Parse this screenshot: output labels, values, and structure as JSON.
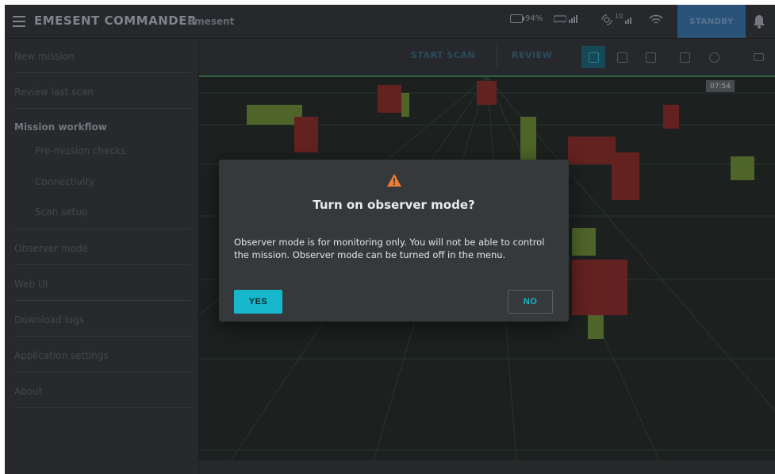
{
  "header": {
    "app_title": "EMESENT COMMANDER",
    "org": "Emesent",
    "battery": "94%",
    "satellites": "10",
    "standby_label": "STANDBY"
  },
  "sidebar": {
    "items": [
      {
        "label": "New mission"
      },
      {
        "label": "Review last scan"
      },
      {
        "label": "Mission workflow"
      },
      {
        "label": "Pre-mission checks"
      },
      {
        "label": "Connectivity"
      },
      {
        "label": "Scan setup"
      },
      {
        "label": "Observer mode"
      },
      {
        "label": "Web UI"
      },
      {
        "label": "Download logs"
      },
      {
        "label": "Application settings"
      },
      {
        "label": "About"
      }
    ]
  },
  "toolbar": {
    "start_scan": "START SCAN",
    "review": "REVIEW",
    "views": [
      "cube-view-icon",
      "front-view-icon",
      "side-view-icon",
      "top-view-icon",
      "fit-view-icon",
      "camera-icon"
    ]
  },
  "viewport": {
    "elapsed_time": "07:54"
  },
  "dialog": {
    "icon": "warning-icon",
    "title": "Turn on observer mode?",
    "body": "Observer mode is for monitoring only. You will not be able to control the mission. Observer mode can be turned off in the menu.",
    "yes_label": "YES",
    "no_label": "NO"
  },
  "colors": {
    "accent": "#17b8cc",
    "warning": "#ef7d33",
    "standby": "#2e5b85"
  }
}
